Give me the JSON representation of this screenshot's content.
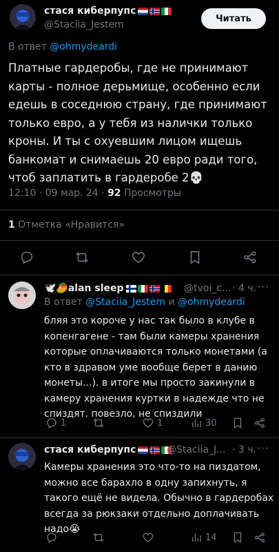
{
  "main_tweet": {
    "author_name": "стася киберпупс",
    "author_handle": "@Staciia_Jestem",
    "follow_label": "Читать",
    "reply_prefix": "В ответ ",
    "reply_mention": "@ohmydeardi",
    "text": "Платные гардеробы, где не принимают карты - полное дерьмище, особенно если едешь в соседнюю страну, где принимают только евро, а у тебя из налички только кроны. И ты с охуевшим лицом ищешь банкомат и снимаешь 20 евро ради того, чтоб заплатить в гардеробе 2💀",
    "time": "12:10 · 09 мар. 24 · ",
    "views_count": "92",
    "views_label": " Просмотры",
    "likes_count": "1",
    "likes_label": " Отметка «Нравится»"
  },
  "reply1": {
    "author_name": "🕊️🥭alan sleep",
    "author_handle": "@tvoi_c...",
    "time": "· 4 ч.",
    "menu": "···",
    "reply_prefix": "В ответ ",
    "reply_mention_1": "@Staciia_Jestem",
    "reply_and": " и ",
    "reply_mention_2": "@ohmydeardi",
    "text": "бляя это короче у нас так было в клубе в копенгагене - там были камеры хранения которые оплачиваются только монетами (а кто в здравом уме вообще берет в данию монеты...). в итоге мы просто закинули в камеру хранения куртки в надежде что не спиздят. повезло, не спиздили",
    "replies": "1",
    "retweets": "",
    "likes": "1",
    "views": "30"
  },
  "reply2": {
    "author_name": "стася киберпупс",
    "author_handle": "@Staciia_J...",
    "time": "· 3 ч.",
    "menu": "···",
    "text": "Камеры хранения это что-то на пиздатом, можно все барахло в одну запихнуть, я такого ещё не видела. Обычно в гардеробах всегда за рюкзаки отдельно доплачивать надо😭",
    "replies": "",
    "retweets": "",
    "likes": "",
    "views": "14"
  },
  "icons": [
    "reply-icon",
    "retweet-icon",
    "like-icon",
    "bookmark-icon",
    "share-icon",
    "views-icon",
    "more-icon"
  ],
  "colors": {
    "background": "#000000",
    "text": "#e7e9ea",
    "muted": "#71767b",
    "link": "#1d9bf0",
    "divider": "#2f3336"
  }
}
